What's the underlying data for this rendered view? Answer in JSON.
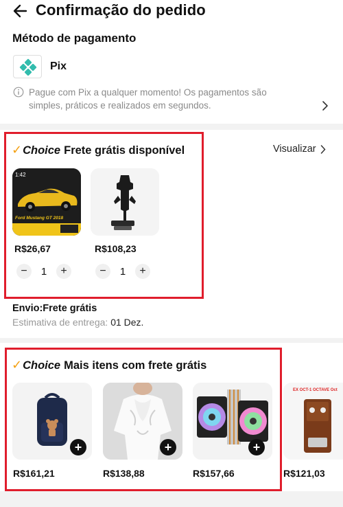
{
  "header": {
    "title": "Confirmação do pedido"
  },
  "payment": {
    "label": "Método de pagamento",
    "method": "Pix",
    "description": "Pague com Pix a qualquer momento! Os pagamentos são simples, práticos e realizados em segundos."
  },
  "choice_section": {
    "brand": "Choice",
    "title": "Frete grátis disponível",
    "view_link": "Visualizar",
    "products": [
      {
        "image": "toy-car-box-image",
        "image_caption": "1:42",
        "box_text": "Ford Mustang GT 2018",
        "price": "R$26,67",
        "quantity": "1",
        "minus": "−",
        "plus": "+"
      },
      {
        "image": "phone-car-holder-image",
        "price": "R$108,23",
        "quantity": "1",
        "minus": "−",
        "plus": "+"
      }
    ],
    "shipping_label": "Envio:Frete grátis",
    "estimate_label": "Estimativa de entrega:",
    "estimate_date": "01 Dez."
  },
  "more_section": {
    "brand": "Choice",
    "title": "Mais itens com frete grátis",
    "items": [
      {
        "image": "backpack-image",
        "price": "R$161,21",
        "add": "+"
      },
      {
        "image": "white-blouse-image",
        "price": "R$138,88",
        "add": "+"
      },
      {
        "image": "cpu-cooler-image",
        "price": "R$157,66",
        "add": "+"
      },
      {
        "image": "guitar-pedal-image",
        "image_caption": "EX OCT-1 OCTAVE Oct",
        "price": "R$121,03"
      }
    ]
  },
  "colors": {
    "accent_red": "#e01d2c",
    "choice_check": "#f4a011",
    "pix_teal": "#32bcad"
  }
}
